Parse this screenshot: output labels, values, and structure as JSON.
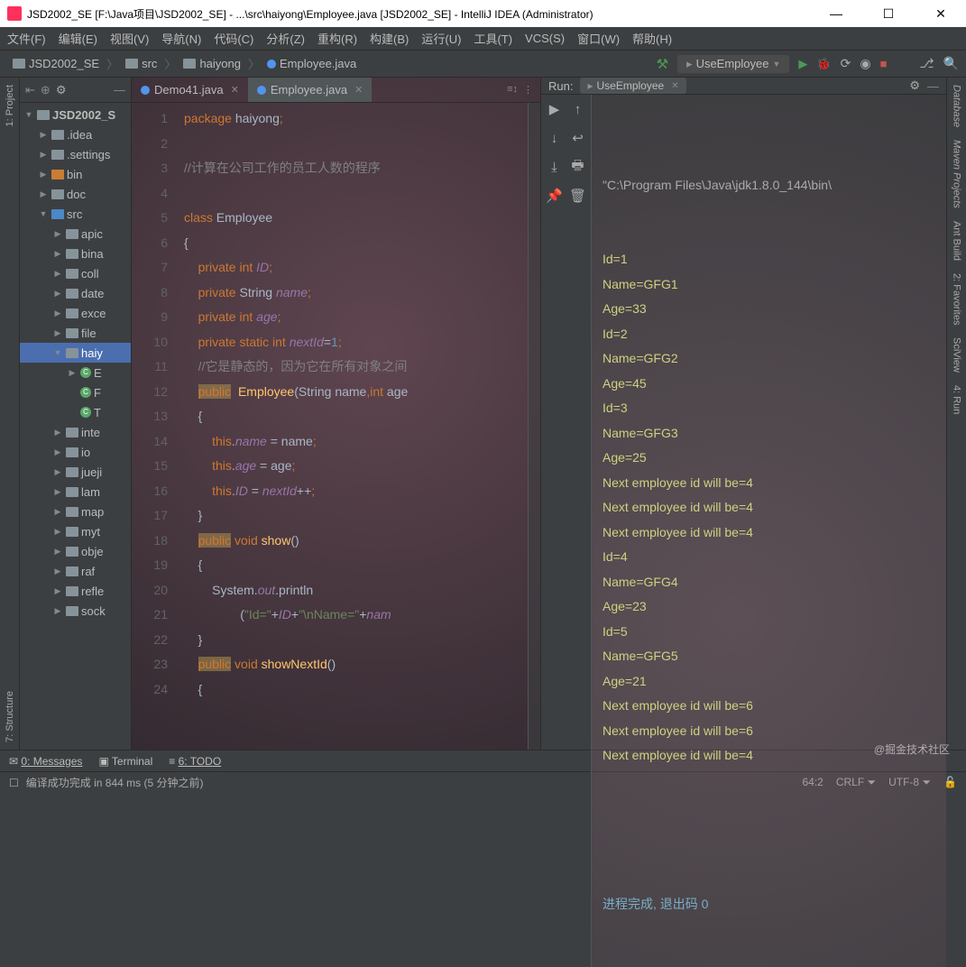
{
  "window": {
    "title": "JSD2002_SE [F:\\Java项目\\JSD2002_SE] - ...\\src\\haiyong\\Employee.java [JSD2002_SE] - IntelliJ IDEA (Administrator)"
  },
  "menus": [
    "文件(F)",
    "编辑(E)",
    "视图(V)",
    "导航(N)",
    "代码(C)",
    "分析(Z)",
    "重构(R)",
    "构建(B)",
    "运行(U)",
    "工具(T)",
    "VCS(S)",
    "窗口(W)",
    "帮助(H)"
  ],
  "breadcrumbs": [
    {
      "label": "JSD2002_SE",
      "icon": "folder"
    },
    {
      "label": "src",
      "icon": "folder"
    },
    {
      "label": "haiyong",
      "icon": "folder"
    },
    {
      "label": "Employee.java",
      "icon": "java"
    }
  ],
  "runconfig": "UseEmployee",
  "project_label": "1: Project",
  "structure_label": "7: Structure",
  "right_tools": [
    "Database",
    "Maven Projects",
    "Ant Build",
    "2: Favorites",
    "SciView",
    "4: Run"
  ],
  "tree": [
    {
      "d": 0,
      "arr": "▼",
      "icon": "folder",
      "label": "JSD2002_S",
      "bold": true
    },
    {
      "d": 1,
      "arr": "▶",
      "icon": "folder",
      "label": ".idea"
    },
    {
      "d": 1,
      "arr": "▶",
      "icon": "folder",
      "label": ".settings"
    },
    {
      "d": 1,
      "arr": "▶",
      "icon": "folder-o",
      "label": "bin"
    },
    {
      "d": 1,
      "arr": "▶",
      "icon": "folder",
      "label": "doc"
    },
    {
      "d": 1,
      "arr": "▼",
      "icon": "folder-b",
      "label": "src"
    },
    {
      "d": 2,
      "arr": "▶",
      "icon": "folder",
      "label": "apic"
    },
    {
      "d": 2,
      "arr": "▶",
      "icon": "folder",
      "label": "bina"
    },
    {
      "d": 2,
      "arr": "▶",
      "icon": "folder",
      "label": "coll"
    },
    {
      "d": 2,
      "arr": "▶",
      "icon": "folder",
      "label": "date"
    },
    {
      "d": 2,
      "arr": "▶",
      "icon": "folder",
      "label": "exce"
    },
    {
      "d": 2,
      "arr": "▶",
      "icon": "folder",
      "label": "file"
    },
    {
      "d": 2,
      "arr": "▼",
      "icon": "folder",
      "label": "haiy",
      "sel": true
    },
    {
      "d": 3,
      "arr": "▶",
      "icon": "class",
      "label": "E"
    },
    {
      "d": 3,
      "arr": "",
      "icon": "class",
      "label": "F"
    },
    {
      "d": 3,
      "arr": "",
      "icon": "class",
      "label": "T"
    },
    {
      "d": 2,
      "arr": "▶",
      "icon": "folder",
      "label": "inte"
    },
    {
      "d": 2,
      "arr": "▶",
      "icon": "folder",
      "label": "io"
    },
    {
      "d": 2,
      "arr": "▶",
      "icon": "folder",
      "label": "jueji"
    },
    {
      "d": 2,
      "arr": "▶",
      "icon": "folder",
      "label": "lam"
    },
    {
      "d": 2,
      "arr": "▶",
      "icon": "folder",
      "label": "map"
    },
    {
      "d": 2,
      "arr": "▶",
      "icon": "folder",
      "label": "myt"
    },
    {
      "d": 2,
      "arr": "▶",
      "icon": "folder",
      "label": "obje"
    },
    {
      "d": 2,
      "arr": "▶",
      "icon": "folder",
      "label": "raf"
    },
    {
      "d": 2,
      "arr": "▶",
      "icon": "folder",
      "label": "refle"
    },
    {
      "d": 2,
      "arr": "▶",
      "icon": "folder",
      "label": "sock"
    }
  ],
  "tabs": [
    {
      "label": "Demo41.java",
      "active": false
    },
    {
      "label": "Employee.java",
      "active": true
    }
  ],
  "code": {
    "start": 1,
    "lines": [
      "<span class='kw'>package</span> haiyong<span class='kw'>;</span>",
      "",
      "<span class='cmt'>//计算在公司工作的员工人数的程序</span>",
      "",
      "<span class='kw'>class</span> Employee",
      "{",
      "    <span class='kw'>private int</span> <span class='fld'>ID</span><span class='kw'>;</span>",
      "    <span class='kw'>private</span> String <span class='fld'>name</span><span class='kw'>;</span>",
      "    <span class='kw'>private int</span> <span class='fld'>age</span><span class='kw'>;</span>",
      "    <span class='kw'>private static int</span> <span class='fld'>nextId</span>=<span class='num'>1</span><span class='kw'>;</span>",
      "    <span class='cmt'>//它是静态的，因为它在所有对象之间</span>",
      "    <span class='kw hl'>public</span>  <span class='fn'>Employee</span>(String name<span class='kw'>,int</span> age",
      "    {",
      "        <span class='kw'>this</span>.<span class='fld'>name</span> = name<span class='kw'>;</span>",
      "        <span class='kw'>this</span>.<span class='fld'>age</span> = age<span class='kw'>;</span>",
      "        <span class='kw'>this</span>.<span class='fld'>ID</span> = <span class='fld'>nextId</span>++<span class='kw'>;</span>",
      "    }",
      "    <span class='kw hl'>public</span> <span class='kw'>void</span> <span class='fn'>show</span>()",
      "    {",
      "        System.<span class='fld'>out</span>.println",
      "                (<span class='str'>\"Id=\"</span>+<span class='fld'>ID</span>+<span class='str'>\"\\nName=\"</span>+<span class='fld'>nam</span>",
      "    }",
      "    <span class='kw hl'>public</span> <span class='kw'>void</span> <span class='fn'>showNextId</span>()",
      "    {"
    ]
  },
  "run": {
    "label": "Run:",
    "tab": "UseEmployee",
    "cmd": "\"C:\\Program Files\\Java\\jdk1.8.0_144\\bin\\",
    "lines": [
      "Id=1",
      "Name=GFG1",
      "Age=33",
      "Id=2",
      "Name=GFG2",
      "Age=45",
      "Id=3",
      "Name=GFG3",
      "Age=25",
      "Next employee id will be=4",
      "Next employee id will be=4",
      "Next employee id will be=4",
      "Id=4",
      "Name=GFG4",
      "Age=23",
      "Id=5",
      "Name=GFG5",
      "Age=21",
      "Next employee id will be=6",
      "Next employee id will be=6",
      "Next employee id will be=4"
    ],
    "exit": "进程完成, 退出码 0"
  },
  "bottom": {
    "messages": "0: Messages",
    "terminal": "Terminal",
    "todo": "6: TODO"
  },
  "status": {
    "msg": "编译成功完成 in 844 ms (5 分钟之前)",
    "pos": "64:2",
    "crlf": "CRLF",
    "enc": "UTF-8"
  },
  "watermark": "@掘金技术社区"
}
